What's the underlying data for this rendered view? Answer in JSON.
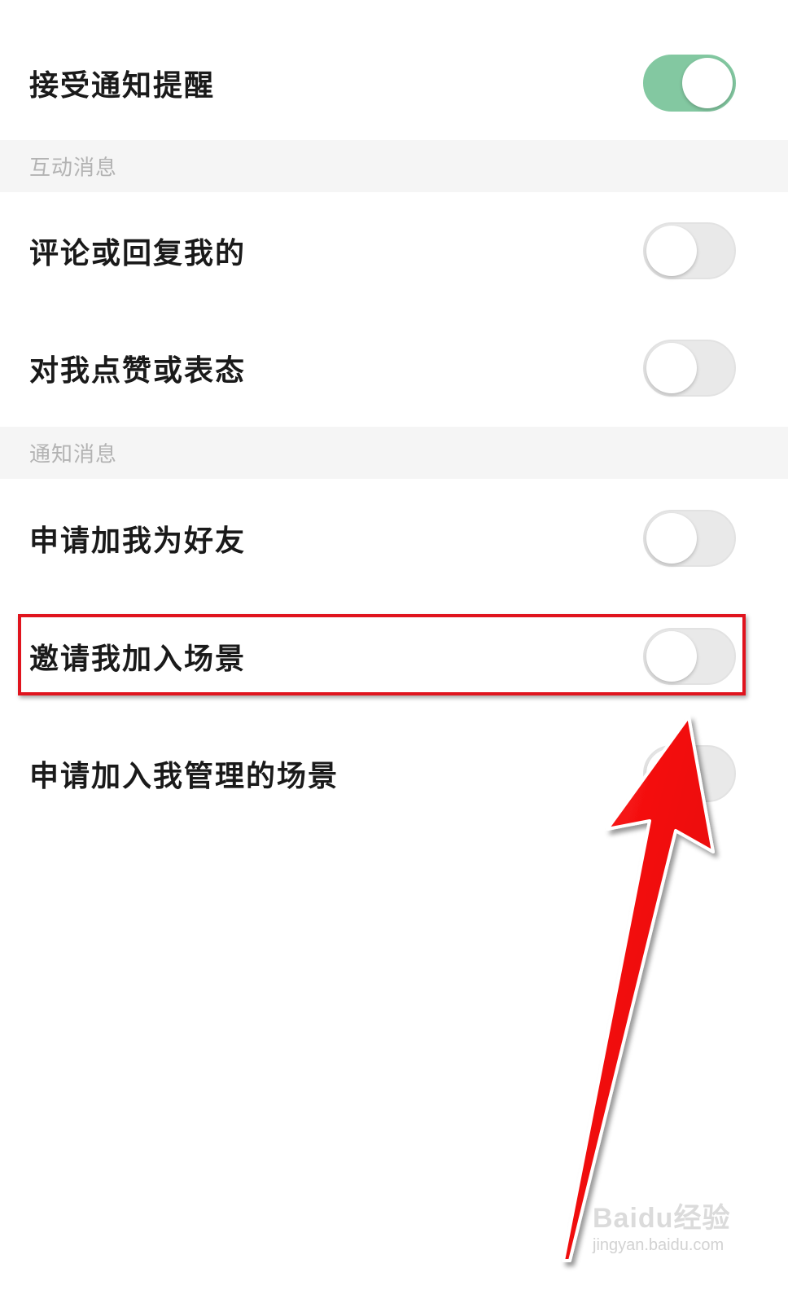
{
  "settings": {
    "receive_notifications": {
      "label": "接受通知提醒",
      "enabled": true
    },
    "sections": [
      {
        "title": "互动消息",
        "items": [
          {
            "label": "评论或回复我的",
            "enabled": false
          },
          {
            "label": "对我点赞或表态",
            "enabled": false
          }
        ]
      },
      {
        "title": "通知消息",
        "items": [
          {
            "label": "申请加我为好友",
            "enabled": false
          },
          {
            "label": "邀请我加入场景",
            "enabled": false
          },
          {
            "label": "申请加入我管理的场景",
            "enabled": false
          }
        ]
      }
    ]
  },
  "watermark": {
    "brand": "Baidu经验",
    "url": "jingyan.baidu.com"
  },
  "colors": {
    "toggle_on": "#83c8a1",
    "toggle_off": "#e9e9e9",
    "section_bg": "#f5f5f5",
    "annotation_red": "#e0141e"
  },
  "icons": {
    "annotation": "red-arrow-icon"
  }
}
